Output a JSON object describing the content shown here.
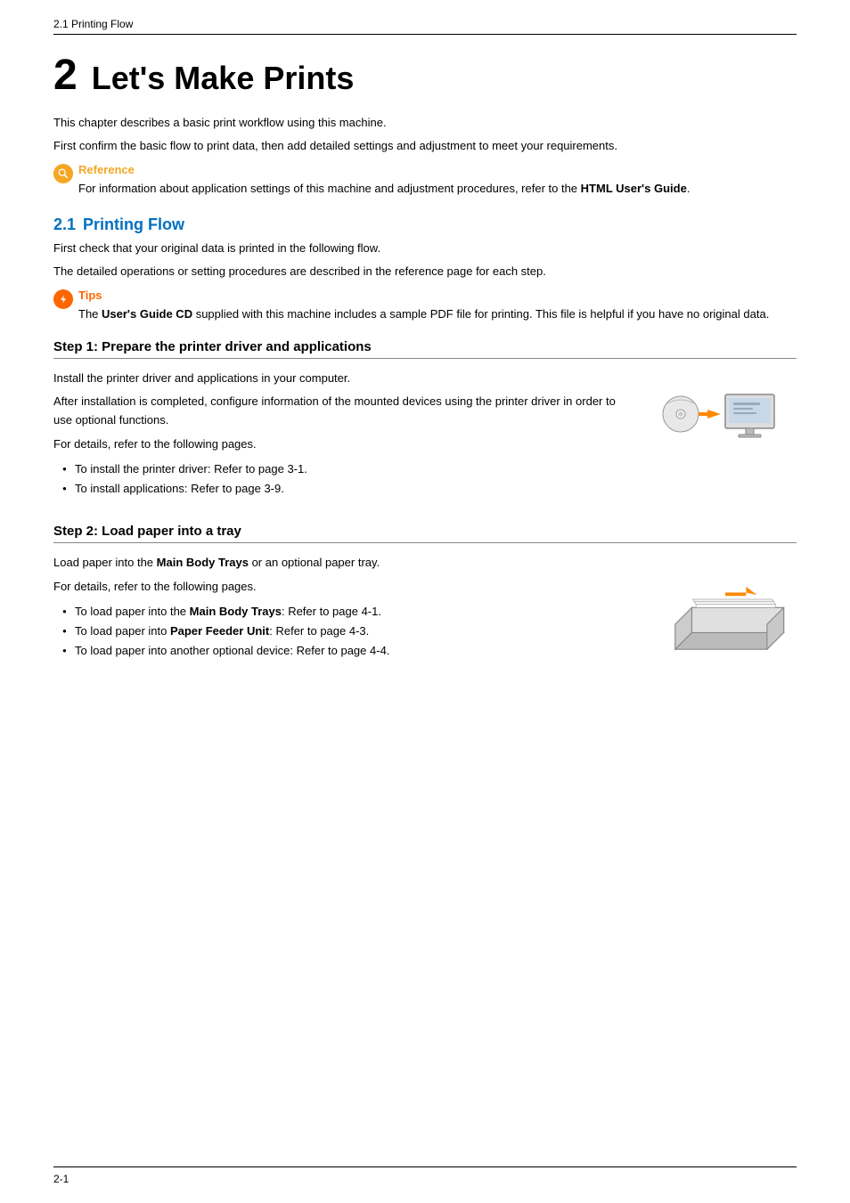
{
  "header": {
    "breadcrumb": "2.1   Printing Flow"
  },
  "chapter": {
    "number": "2",
    "title": "Let's Make Prints"
  },
  "intro": {
    "line1": "This chapter describes a basic print workflow using this machine.",
    "line2": "First confirm the basic flow to print data, then add detailed settings and adjustment to meet your requirements."
  },
  "reference": {
    "label": "Reference",
    "text_before": "For information about application settings of this machine and adjustment procedures, refer to the ",
    "text_bold": "HTML User's Guide",
    "text_after": "."
  },
  "section_2_1": {
    "number": "2.1",
    "title": "Printing Flow",
    "desc1": "First check that your original data is printed in the following flow.",
    "desc2": "The detailed operations or setting procedures are described in the reference page for each step."
  },
  "tips": {
    "label": "Tips",
    "text_before": "The ",
    "text_bold": "User's Guide CD",
    "text_after": " supplied with this machine includes a sample PDF file for printing. This file is helpful if you have no original data."
  },
  "step1": {
    "heading": "Step 1: Prepare the printer driver and applications",
    "para1": "Install the printer driver and applications in your computer.",
    "para2": "After installation is completed, configure information of the mounted devices using the printer driver in order to use optional functions.",
    "para3": "For details, refer to the following pages.",
    "bullets": [
      "To install the printer driver: Refer to page 3-1.",
      "To install applications: Refer to page 3-9."
    ]
  },
  "step2": {
    "heading": "Step 2: Load paper into a tray",
    "para1_before": "Load paper into the ",
    "para1_bold": "Main Body Trays",
    "para1_after": " or an optional paper tray.",
    "para2": "For details, refer to the following pages.",
    "bullets": [
      {
        "before": "To load paper into the ",
        "bold": "Main Body Trays",
        "after": ": Refer to page 4-1."
      },
      {
        "before": "To load paper into ",
        "bold": "Paper Feeder Unit",
        "after": ": Refer to page 4-3."
      },
      {
        "before": "To load paper into another optional device: Refer to page 4-4.",
        "bold": "",
        "after": ""
      }
    ]
  },
  "footer": {
    "page": "2-1"
  }
}
